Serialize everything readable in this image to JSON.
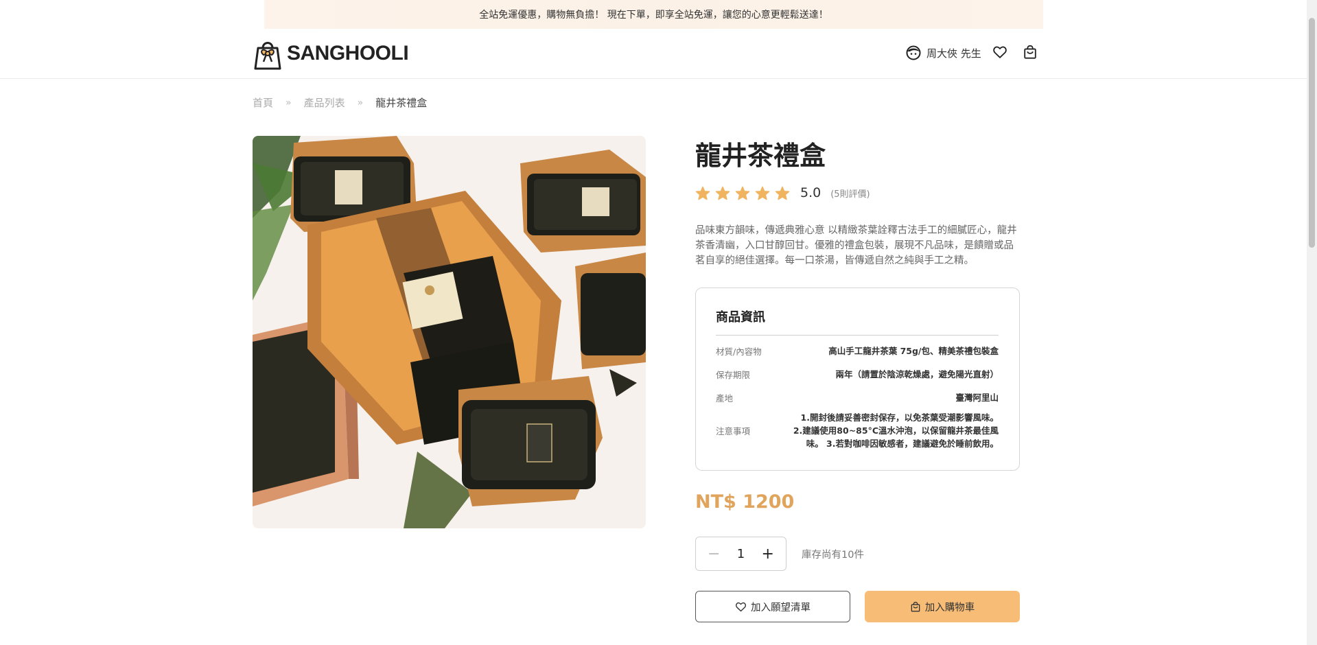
{
  "announcement": "全站免運優惠，購物無負擔！ 現在下單，即享全站免運，讓您的心意更輕鬆送達！",
  "brand": {
    "name": "SANGHOOLI"
  },
  "header": {
    "user_name": "周大俠 先生",
    "icons": [
      "user-face-icon",
      "heart-icon",
      "shopping-bag-icon"
    ]
  },
  "breadcrumb": {
    "items": [
      "首頁",
      "產品列表",
      "龍井茶禮盒"
    ],
    "separator": "»"
  },
  "product": {
    "title": "龍井茶禮盒",
    "rating_value": "5.0",
    "rating_stars": 5,
    "review_count": "(5則評價)",
    "description": "品味東方韻味，傳遞典雅心意 以精緻茶葉詮釋古法手工的細膩匠心，龍井茶香清幽，入口甘醇回甘。優雅的禮盒包裝，展現不凡品味，是饋贈或品茗自享的絕佳選擇。每一口茶湯，皆傳遞自然之純與手工之精。",
    "info": {
      "heading": "商品資訊",
      "rows": [
        {
          "label": "材質/內容物",
          "value": "高山手工龍井茶葉 75g/包、精美茶禮包裝盒"
        },
        {
          "label": "保存期限",
          "value": "兩年（請置於陰涼乾燥處，避免陽光直射）"
        },
        {
          "label": "產地",
          "value": "臺灣阿里山"
        },
        {
          "label": "注意事項",
          "value": "1.開封後請妥善密封保存，以免茶葉受潮影響風味。 2.建議使用80~85°C溫水沖泡，以保留龍井茶最佳風味。 3.若對咖啡因敏感者，建議避免於睡前飲用。"
        }
      ]
    },
    "price": "NT$ 1200",
    "quantity": "1",
    "stock_text": "庫存尚有10件",
    "buttons": {
      "wishlist": "加入願望清單",
      "cart": "加入購物車"
    }
  },
  "colors": {
    "accent": "#e0a45c",
    "cart_button": "#f7bd77",
    "star": "#f0b35f",
    "announce_bg": "#fbf1e6"
  }
}
